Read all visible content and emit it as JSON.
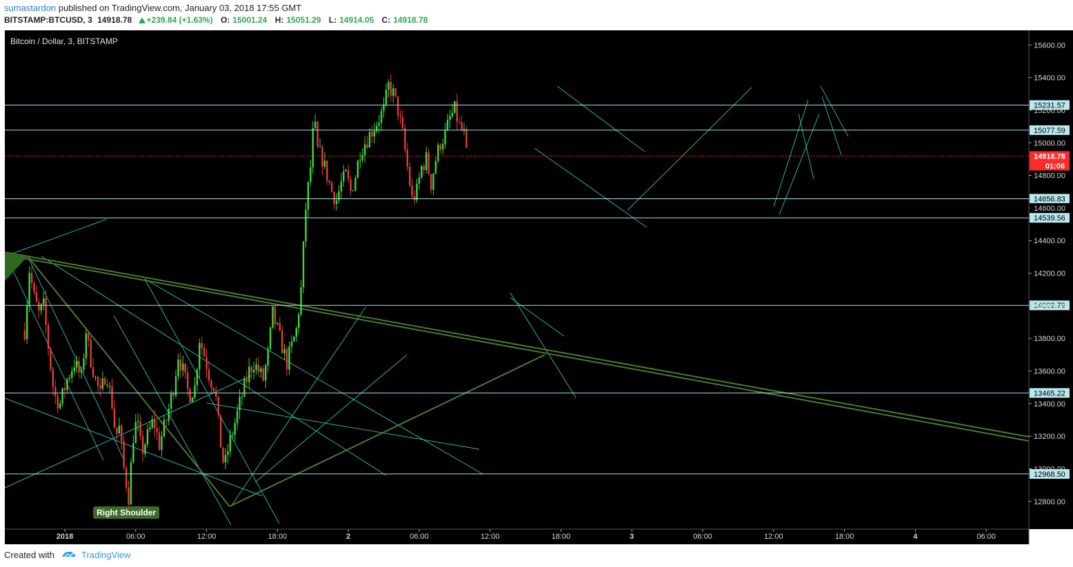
{
  "header": {
    "author": "sumastardon",
    "published": "published on TradingView.com, January 03, 2018 17:55 GMT",
    "symbol": "BITSTAMP:BTCUSD, 3",
    "last": "14918.78",
    "change": "+239.84 (+1.63%)",
    "o_label": "O:",
    "o_value": "15001.24",
    "h_label": "H:",
    "h_value": "15051.29",
    "l_label": "L:",
    "l_value": "14914.05",
    "c_label": "C:",
    "c_value": "14918.78"
  },
  "footer": {
    "created": "Created with",
    "brand": "TradingView"
  },
  "colors": {
    "background": "#000000",
    "up": "#3ddc3d",
    "down": "#e83b3b",
    "level_line": "#a8e4ec",
    "trend_line": "#2bb5a0",
    "heavy_trend": "#4e7a2e",
    "price_label": "#b8e9ef",
    "current_price": "#ff2a2a"
  },
  "chart_data": {
    "type": "candlestick",
    "title": "Bitcoin / Dollar, 3, BITSTAMP",
    "x_tick_labels": [
      "2018",
      "06:00",
      "12:00",
      "18:00",
      "2",
      "06:00",
      "12:00",
      "18:00",
      "3",
      "06:00",
      "12:00",
      "18:00",
      "4",
      "06:00"
    ],
    "y_tick_labels": [
      "15600.00",
      "15400.00",
      "15200.00",
      "15000.00",
      "14800.00",
      "14600.00",
      "14400.00",
      "14200.00",
      "14000.00",
      "13800.00",
      "13600.00",
      "13400.00",
      "13200.00",
      "13000.00",
      "12800.00"
    ],
    "ylim": [
      12630,
      15690
    ],
    "y_ticks": [
      15600,
      15400,
      15200,
      15000,
      14800,
      14600,
      14400,
      14200,
      14000,
      13800,
      13600,
      13400,
      13200,
      13000,
      12800
    ],
    "price_path": [
      [
        -3.4,
        13850
      ],
      [
        -3.0,
        14220
      ],
      [
        -2.6,
        14050
      ],
      [
        -2.2,
        13950
      ],
      [
        -1.8,
        14000
      ],
      [
        -1.4,
        13750
      ],
      [
        -0.9,
        13450
      ],
      [
        -0.4,
        13400
      ],
      [
        0.2,
        13550
      ],
      [
        0.8,
        13650
      ],
      [
        1.4,
        13560
      ],
      [
        1.8,
        13850
      ],
      [
        2.1,
        13700
      ],
      [
        2.6,
        13550
      ],
      [
        3.0,
        13450
      ],
      [
        3.5,
        13600
      ],
      [
        4.0,
        13400
      ],
      [
        4.3,
        13200
      ],
      [
        4.6,
        13250
      ],
      [
        5.0,
        13000
      ],
      [
        5.4,
        12830
      ],
      [
        5.8,
        13200
      ],
      [
        6.1,
        13300
      ],
      [
        6.5,
        13100
      ],
      [
        7.0,
        13200
      ],
      [
        7.5,
        13300
      ],
      [
        8.0,
        13150
      ],
      [
        8.6,
        13300
      ],
      [
        9.2,
        13500
      ],
      [
        9.6,
        13700
      ],
      [
        10.0,
        13600
      ],
      [
        10.5,
        13450
      ],
      [
        11.0,
        13500
      ],
      [
        11.4,
        13800
      ],
      [
        11.8,
        13700
      ],
      [
        12.3,
        13550
      ],
      [
        12.7,
        13500
      ],
      [
        13.1,
        13200
      ],
      [
        13.5,
        13000
      ],
      [
        13.9,
        13150
      ],
      [
        14.3,
        13250
      ],
      [
        14.8,
        13400
      ],
      [
        15.2,
        13500
      ],
      [
        15.6,
        13600
      ],
      [
        16.0,
        13650
      ],
      [
        16.4,
        13600
      ],
      [
        16.8,
        13550
      ],
      [
        17.2,
        13700
      ],
      [
        17.6,
        13950
      ],
      [
        18.0,
        13850
      ],
      [
        18.4,
        13750
      ],
      [
        18.8,
        13650
      ],
      [
        19.2,
        13750
      ],
      [
        19.6,
        13850
      ],
      [
        20.0,
        14100
      ],
      [
        20.4,
        14600
      ],
      [
        20.8,
        14850
      ],
      [
        21.1,
        15150
      ],
      [
        21.4,
        14950
      ],
      [
        21.8,
        14900
      ],
      [
        22.2,
        14800
      ],
      [
        22.6,
        14700
      ],
      [
        23.0,
        14650
      ],
      [
        23.4,
        14750
      ],
      [
        23.8,
        14800
      ],
      [
        24.2,
        14700
      ],
      [
        24.6,
        14800
      ],
      [
        25.0,
        14950
      ],
      [
        25.4,
        15000
      ],
      [
        25.8,
        15050
      ],
      [
        26.2,
        15100
      ],
      [
        26.6,
        15150
      ],
      [
        27.0,
        15200
      ],
      [
        27.4,
        15350
      ],
      [
        27.8,
        15300
      ],
      [
        28.2,
        15200
      ],
      [
        28.6,
        15050
      ],
      [
        29.0,
        14850
      ],
      [
        29.4,
        14650
      ],
      [
        29.8,
        14700
      ],
      [
        30.2,
        14850
      ],
      [
        30.6,
        14900
      ],
      [
        31.0,
        14750
      ],
      [
        31.4,
        14900
      ],
      [
        31.8,
        15000
      ],
      [
        32.2,
        15050
      ],
      [
        32.6,
        15150
      ],
      [
        33.0,
        15200
      ],
      [
        33.4,
        15100
      ],
      [
        33.8,
        15050
      ],
      [
        34.0,
        14920
      ]
    ],
    "horizontal_levels": [
      {
        "label": "15231.57",
        "value": 15231.57
      },
      {
        "label": "15077.59",
        "value": 15077.59
      },
      {
        "label": "14656.83",
        "value": 14656.83
      },
      {
        "label": "14539.56",
        "value": 14539.56
      },
      {
        "label": "14002.79",
        "value": 14002.79
      },
      {
        "label": "13465.22",
        "value": 13465.22
      },
      {
        "label": "12968.50",
        "value": 12968.5
      }
    ],
    "current_price": {
      "label": "14918.78",
      "countdown": "01:06",
      "value": 14918.78
    },
    "axis_label_14600": "14600.00",
    "annotation": {
      "text": "Right Shoulder",
      "x": 5.2,
      "y": 12727
    }
  }
}
